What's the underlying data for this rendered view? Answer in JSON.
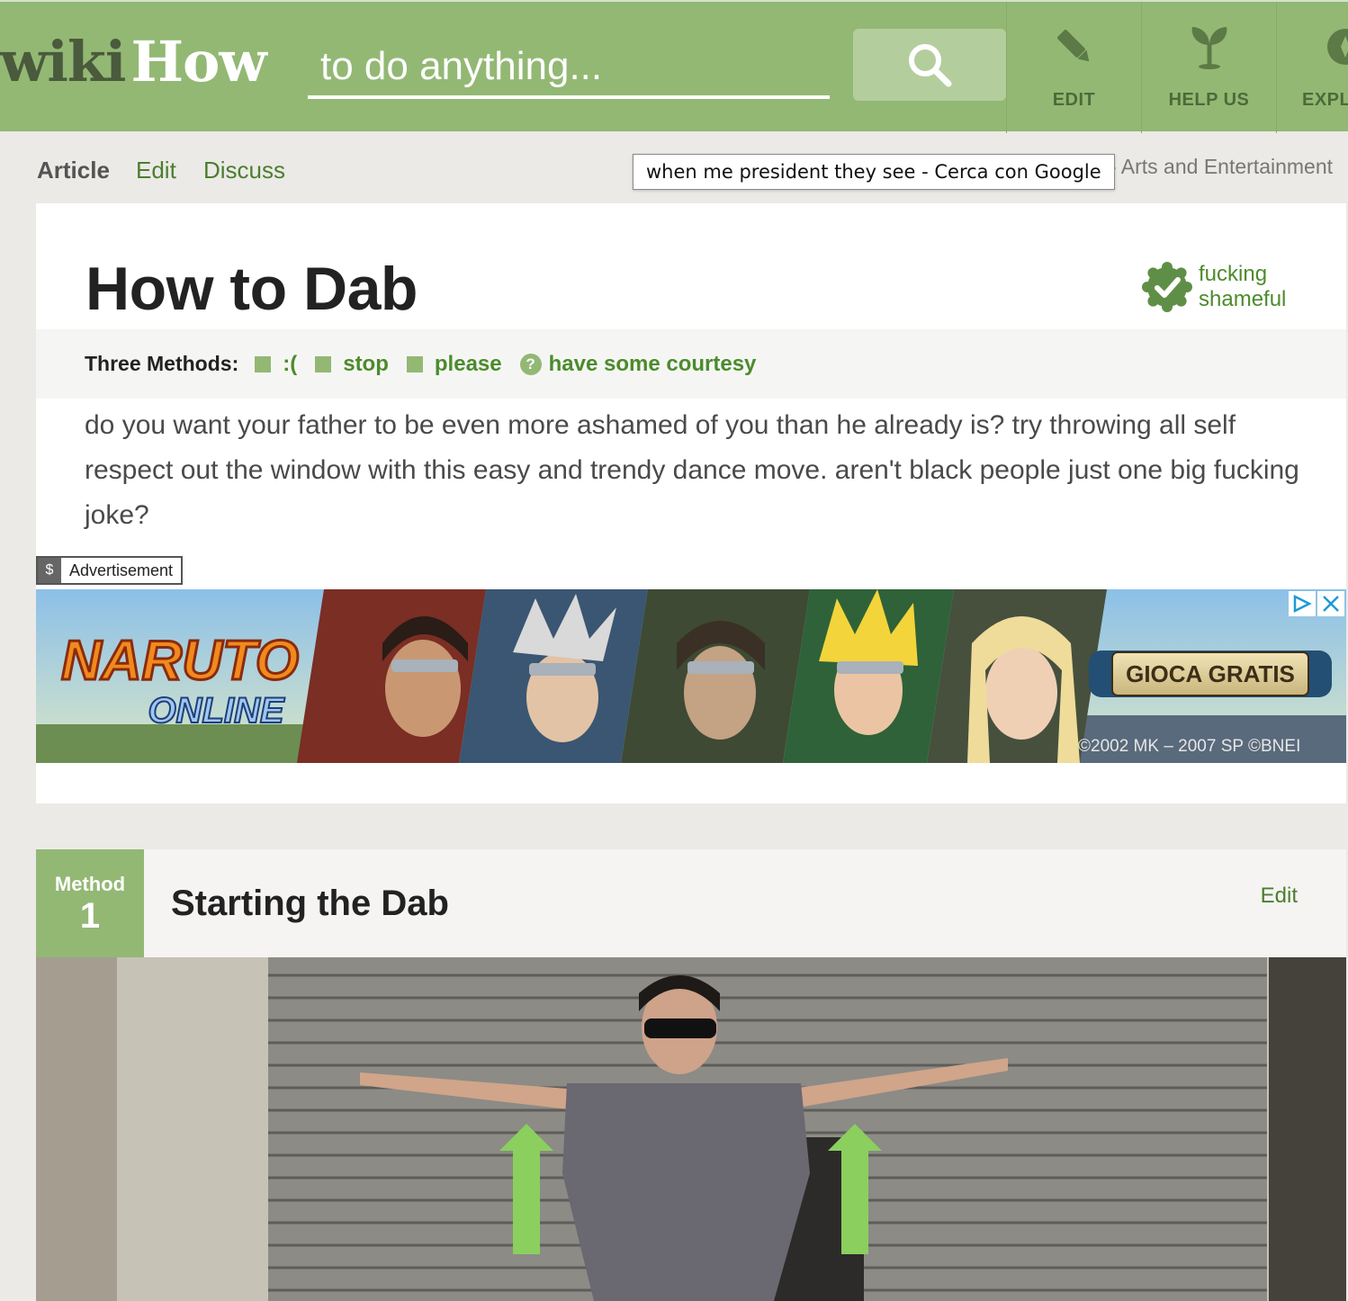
{
  "header": {
    "logo_wiki": "wiki",
    "logo_how": "How",
    "search_placeholder": "to do anything...",
    "nav": [
      {
        "label": "EDIT",
        "icon": "pencil-icon"
      },
      {
        "label": "HELP US",
        "icon": "sprout-icon"
      },
      {
        "label": "EXPL",
        "icon": "compass-icon"
      }
    ]
  },
  "subnav": {
    "tabs": [
      "Article",
      "Edit",
      "Discuss"
    ],
    "tooltip": "when me president they see - Cerca con Google",
    "breadcrumb": "› Arts and Entertainment"
  },
  "article": {
    "title": "How to Dab",
    "badge_line1": "fucking",
    "badge_line2": "shameful",
    "methods_label": "Three Methods:",
    "methods": [
      ":(",
      "stop",
      "please"
    ],
    "extra_link": "have some courtesy",
    "intro": "do you want your father to be even more ashamed of you than he already is? try throwing all self respect out the window with this easy and trendy dance move. aren't black people just one big fucking joke?"
  },
  "ad": {
    "label_symbol": "$",
    "label": "Advertisement",
    "brand_top": "NARUTO",
    "brand_bottom": "ONLINE",
    "cta": "GIOCA GRATIS",
    "copyright": "©2002 MK – 2007 SP   ©BNEI"
  },
  "method": {
    "label": "Method",
    "number": "1",
    "title": "Starting the Dab",
    "edit": "Edit"
  },
  "colors": {
    "brand_green": "#93b874",
    "link_green": "#4c8b2c",
    "page_bg": "#ebeae7"
  }
}
